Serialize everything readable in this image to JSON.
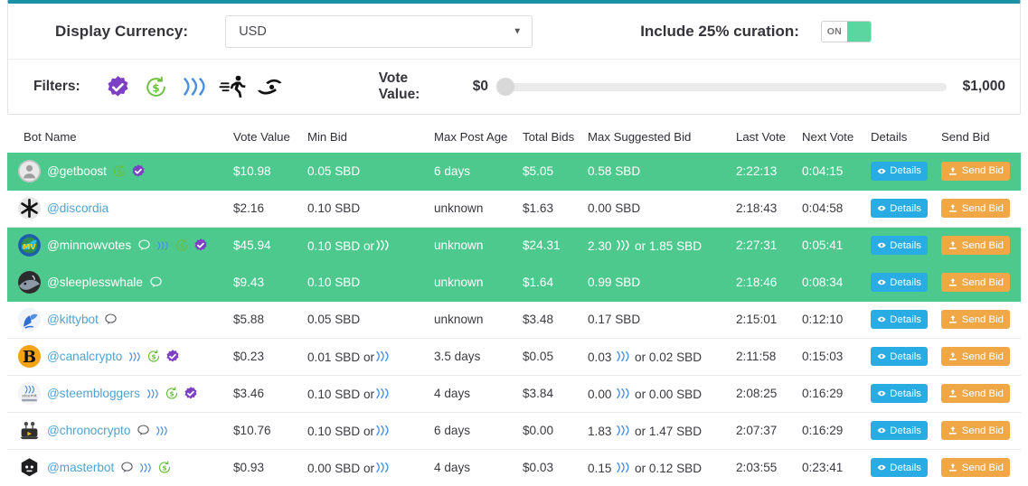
{
  "controls": {
    "currency_label": "Display Currency:",
    "currency_value": "USD",
    "curation_label": "Include 25% curation:",
    "curation_toggle_state": "ON",
    "filters_label": "Filters:",
    "filter_icons": [
      "verified-badge-icon",
      "refund-dollar-icon",
      "steem-logo-icon",
      "running-person-icon",
      "hand-coin-icon"
    ],
    "vote_value_label": "Vote Value:",
    "vote_value_min": "$0",
    "vote_value_max": "$1,000"
  },
  "table": {
    "headers": [
      "Bot Name",
      "Vote Value",
      "Min Bid",
      "Max Post Age",
      "Total Bids",
      "Max Suggested Bid",
      "Last Vote",
      "Next Vote",
      "Details",
      "Send Bid"
    ],
    "details_label": "Details",
    "sendbid_label": "Send Bid",
    "rows": [
      {
        "name": "@getboost",
        "avatar": "person-placeholder-avatar",
        "badges": [
          "refund-dollar-icon",
          "verified-badge-icon"
        ],
        "vote_value": "$10.98",
        "min_bid": "0.05 SBD",
        "max_post_age": "6 days",
        "total_bids": "$5.05",
        "max_suggested_bid": "0.58 SBD",
        "last_vote": "2:22:13",
        "next_vote": "0:04:15",
        "highlight": true
      },
      {
        "name": "@discordia",
        "avatar": "asterisk-avatar",
        "badges": [],
        "vote_value": "$2.16",
        "min_bid": "0.10 SBD",
        "max_post_age": "unknown",
        "total_bids": "$1.63",
        "max_suggested_bid": "0.00 SBD",
        "last_vote": "2:18:43",
        "next_vote": "0:04:58",
        "highlight": false
      },
      {
        "name": "@minnowvotes",
        "avatar": "minnowvotes-avatar",
        "badges": [
          "comment-icon",
          "steem-logo-icon",
          "refund-dollar-icon",
          "verified-badge-icon"
        ],
        "vote_value": "$45.94",
        "min_bid": "0.10 SBD or",
        "min_bid_steem": true,
        "max_post_age": "unknown",
        "total_bids": "$24.31",
        "max_suggested_bid_pre": "2.30",
        "max_suggested_bid_post": "or 1.85 SBD",
        "last_vote": "2:27:31",
        "next_vote": "0:05:41",
        "highlight": true
      },
      {
        "name": "@sleeplesswhale",
        "avatar": "whale-avatar",
        "badges": [
          "comment-icon"
        ],
        "vote_value": "$9.43",
        "min_bid": "0.10 SBD",
        "max_post_age": "unknown",
        "total_bids": "$1.64",
        "max_suggested_bid": "0.99 SBD",
        "last_vote": "2:18:46",
        "next_vote": "0:08:34",
        "highlight": true
      },
      {
        "name": "@kittybot",
        "avatar": "kitty-avatar",
        "badges": [
          "comment-icon"
        ],
        "vote_value": "$5.88",
        "min_bid": "0.05 SBD",
        "max_post_age": "unknown",
        "total_bids": "$3.48",
        "max_suggested_bid": "0.17 SBD",
        "last_vote": "2:15:01",
        "next_vote": "0:12:10",
        "highlight": false
      },
      {
        "name": "@canalcrypto",
        "avatar": "bitcoin-avatar",
        "badges": [
          "steem-logo-icon",
          "refund-dollar-icon",
          "verified-badge-icon"
        ],
        "vote_value": "$0.23",
        "min_bid": "0.01 SBD or",
        "min_bid_steem": true,
        "max_post_age": "3.5 days",
        "total_bids": "$0.05",
        "max_suggested_bid_pre": "0.03",
        "max_suggested_bid_post": "or 0.02 SBD",
        "last_vote": "2:11:58",
        "next_vote": "0:15:03",
        "highlight": false
      },
      {
        "name": "@steembloggers",
        "avatar": "steembloggers-avatar",
        "badges": [
          "steem-logo-icon",
          "refund-dollar-icon",
          "verified-badge-icon"
        ],
        "vote_value": "$3.46",
        "min_bid": "0.10 SBD or",
        "min_bid_steem": true,
        "max_post_age": "4 days",
        "total_bids": "$3.84",
        "max_suggested_bid_pre": "0.00",
        "max_suggested_bid_post": "or 0.00 SBD",
        "last_vote": "2:08:25",
        "next_vote": "0:16:29",
        "highlight": false
      },
      {
        "name": "@chronocrypto",
        "avatar": "robot-avatar",
        "badges": [
          "comment-icon",
          "steem-logo-icon"
        ],
        "vote_value": "$10.76",
        "min_bid": "0.10 SBD or",
        "min_bid_steem": true,
        "max_post_age": "6 days",
        "total_bids": "$0.00",
        "max_suggested_bid_pre": "1.83",
        "max_suggested_bid_post": "or 1.47 SBD",
        "last_vote": "2:07:37",
        "next_vote": "0:16:29",
        "highlight": false
      },
      {
        "name": "@masterbot",
        "avatar": "masterbot-avatar",
        "badges": [
          "comment-icon",
          "steem-logo-icon",
          "refund-dollar-icon"
        ],
        "vote_value": "$0.93",
        "min_bid": "0.00 SBD or",
        "min_bid_steem": true,
        "max_post_age": "4 days",
        "total_bids": "$0.03",
        "max_suggested_bid_pre": "0.15",
        "max_suggested_bid_post": "or 0.12 SBD",
        "last_vote": "2:03:55",
        "next_vote": "0:23:41",
        "highlight": false
      }
    ]
  },
  "colors": {
    "accent_teal": "#1b92a4",
    "row_highlight_green": "#4dc98d",
    "details_blue": "#29ace3",
    "sendbid_orange": "#f0a847",
    "link_blue": "#4fa3d1",
    "toggle_green": "#5cd6a0"
  }
}
